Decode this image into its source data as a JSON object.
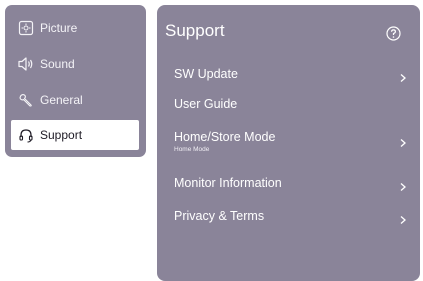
{
  "sidebar": {
    "items": [
      {
        "label": "Picture",
        "icon": "picture-icon",
        "active": false
      },
      {
        "label": "Sound",
        "icon": "speaker-icon",
        "active": false
      },
      {
        "label": "General",
        "icon": "wrench-icon",
        "active": false
      },
      {
        "label": "Support",
        "icon": "headset-icon",
        "active": true
      }
    ]
  },
  "main": {
    "title": "Support",
    "help_icon": "question-circle-icon",
    "items": [
      {
        "label": "SW Update",
        "sub": "",
        "has_chevron": true
      },
      {
        "label": "User Guide",
        "sub": "",
        "has_chevron": false
      },
      {
        "label": "Home/Store Mode",
        "sub": "Home Mode",
        "has_chevron": true
      },
      {
        "label": "Monitor Information",
        "sub": "",
        "has_chevron": true
      },
      {
        "label": "Privacy & Terms",
        "sub": "",
        "has_chevron": true
      }
    ]
  },
  "colors": {
    "panel_bg": "#8a8499",
    "active_bg": "#ffffff",
    "text": "#ffffff"
  }
}
